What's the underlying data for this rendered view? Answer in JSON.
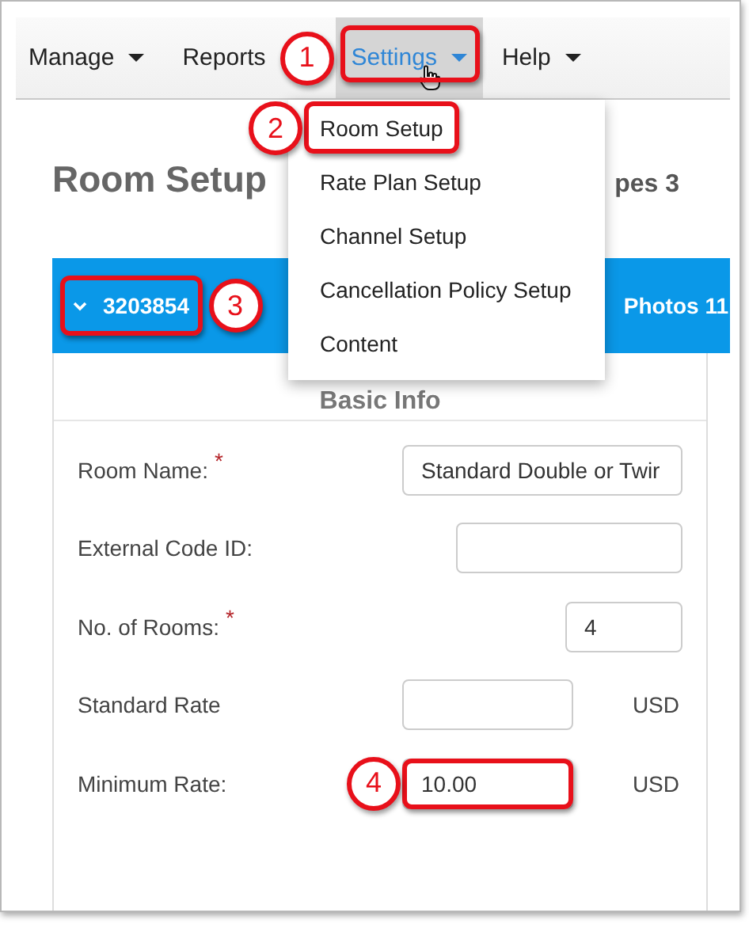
{
  "nav": [
    {
      "label": "Manage",
      "caret": true,
      "selected": false
    },
    {
      "label": "Reports",
      "caret": false,
      "selected": false
    },
    {
      "label": "Settings",
      "caret": true,
      "selected": true,
      "callout": "1"
    },
    {
      "label": "Help",
      "caret": true,
      "selected": false
    }
  ],
  "dropdown": [
    {
      "label": "Room Setup",
      "callout": "2"
    },
    {
      "label": "Rate Plan Setup"
    },
    {
      "label": "Channel Setup"
    },
    {
      "label": "Cancellation Policy Setup"
    },
    {
      "label": "Content"
    }
  ],
  "page": {
    "title": "Room Setup",
    "room_types": "pes 3"
  },
  "room": {
    "id": "3203854",
    "expanded": true,
    "photos": "Photos 11",
    "callout": "3"
  },
  "section_title": "Basic Info",
  "fields": [
    {
      "kind": "name",
      "label": "Room Name:",
      "mark": "*",
      "value": "Standard Double or Twir"
    },
    {
      "kind": "code",
      "label": "External Code ID:"
    },
    {
      "kind": "count",
      "label": "No. of Rooms:",
      "mark": "*",
      "value": "4"
    },
    {
      "kind": "rate",
      "label": "Standard Rate",
      "unit": "USD"
    },
    {
      "kind": "rate",
      "label": "Minimum Rate:",
      "value": "10.00",
      "unit": "USD",
      "callout": "4"
    }
  ]
}
